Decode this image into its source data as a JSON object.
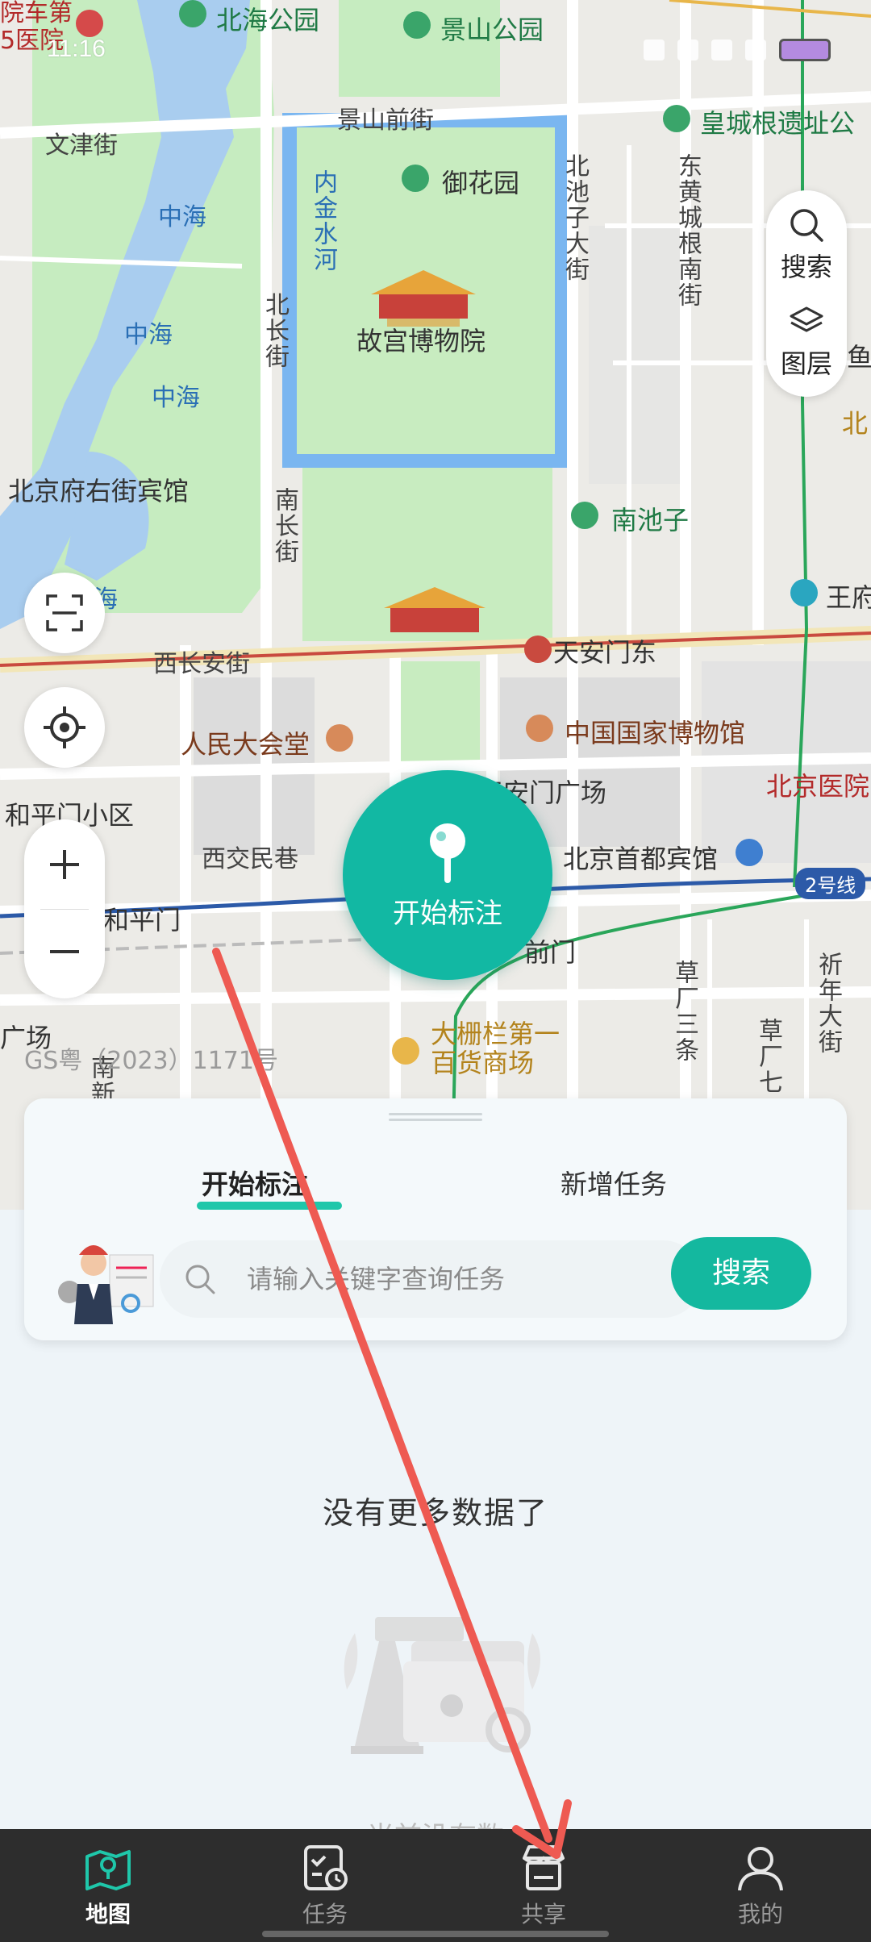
{
  "status_bar": {
    "time": "11:16"
  },
  "map": {
    "labels": {
      "hospital": "院车第\n5医院",
      "beihai": "北海公园",
      "jingshan": "景山公园",
      "jingshan_front": "景山前街",
      "huangcheng": "皇城根遗址公",
      "wenjin": "文津街",
      "yuhuayuan": "御花园",
      "beichizi": "北池子大街",
      "donghuangcheng": "东黄城根南街",
      "jinshui": "内金水河",
      "zhonghai1": "中海",
      "zhonghai2": "中海",
      "zhonghai3": "中海",
      "gugong": "故宫博物院",
      "beichang": "北长街",
      "nanchang": "南长街",
      "beijingfu": "北京府右街宾馆",
      "nanhai": "海",
      "nanchizi": "南池子",
      "wangfujing": "王府",
      "xichangan": "西长安街",
      "tiananmen_east": "天安门东",
      "renmin": "人民大会堂",
      "museum": "中国国家博物馆",
      "heping_xq": "和平门小区",
      "tiananmen_sq": "天安门广场",
      "beijing_hosp": "北京医院",
      "xijiao": "西交民巷",
      "capital_hotel": "北京首都宾馆",
      "line2": "2号线",
      "hepingmen": "和平门",
      "qianmen": "前门",
      "caochang3": "草厂三条",
      "caochang7": "草厂七",
      "qiannian": "祈年大街",
      "dashilan": "大栅栏第一\n百货商场",
      "nanxin": "南新",
      "guangchang": "广场",
      "yu": "鱼",
      "bei": "北"
    },
    "tools": {
      "search": "搜索",
      "layers": "图层"
    },
    "start_button": "开始标注",
    "gs_number": "GS粤（2023）1171号"
  },
  "card": {
    "tabs": [
      "开始标注",
      "新增任务"
    ],
    "search_placeholder": "请输入关键字查询任务",
    "search_button": "搜索"
  },
  "empty": {
    "no_more": "没有更多数据了",
    "empty_text": "当前没有数"
  },
  "nav": {
    "items": [
      {
        "label": "地图",
        "icon": "map-icon",
        "active": true
      },
      {
        "label": "任务",
        "icon": "task-icon",
        "active": false
      },
      {
        "label": "共享",
        "icon": "share-store-icon",
        "active": false
      },
      {
        "label": "我的",
        "icon": "profile-icon",
        "active": false
      }
    ]
  },
  "colors": {
    "accent": "#12b8a3",
    "nav_bg": "#2d2d2d",
    "palace_green": "#c8ecc0",
    "moat": "#7ab6f0",
    "annotation_arrow": "#ee5a52"
  }
}
